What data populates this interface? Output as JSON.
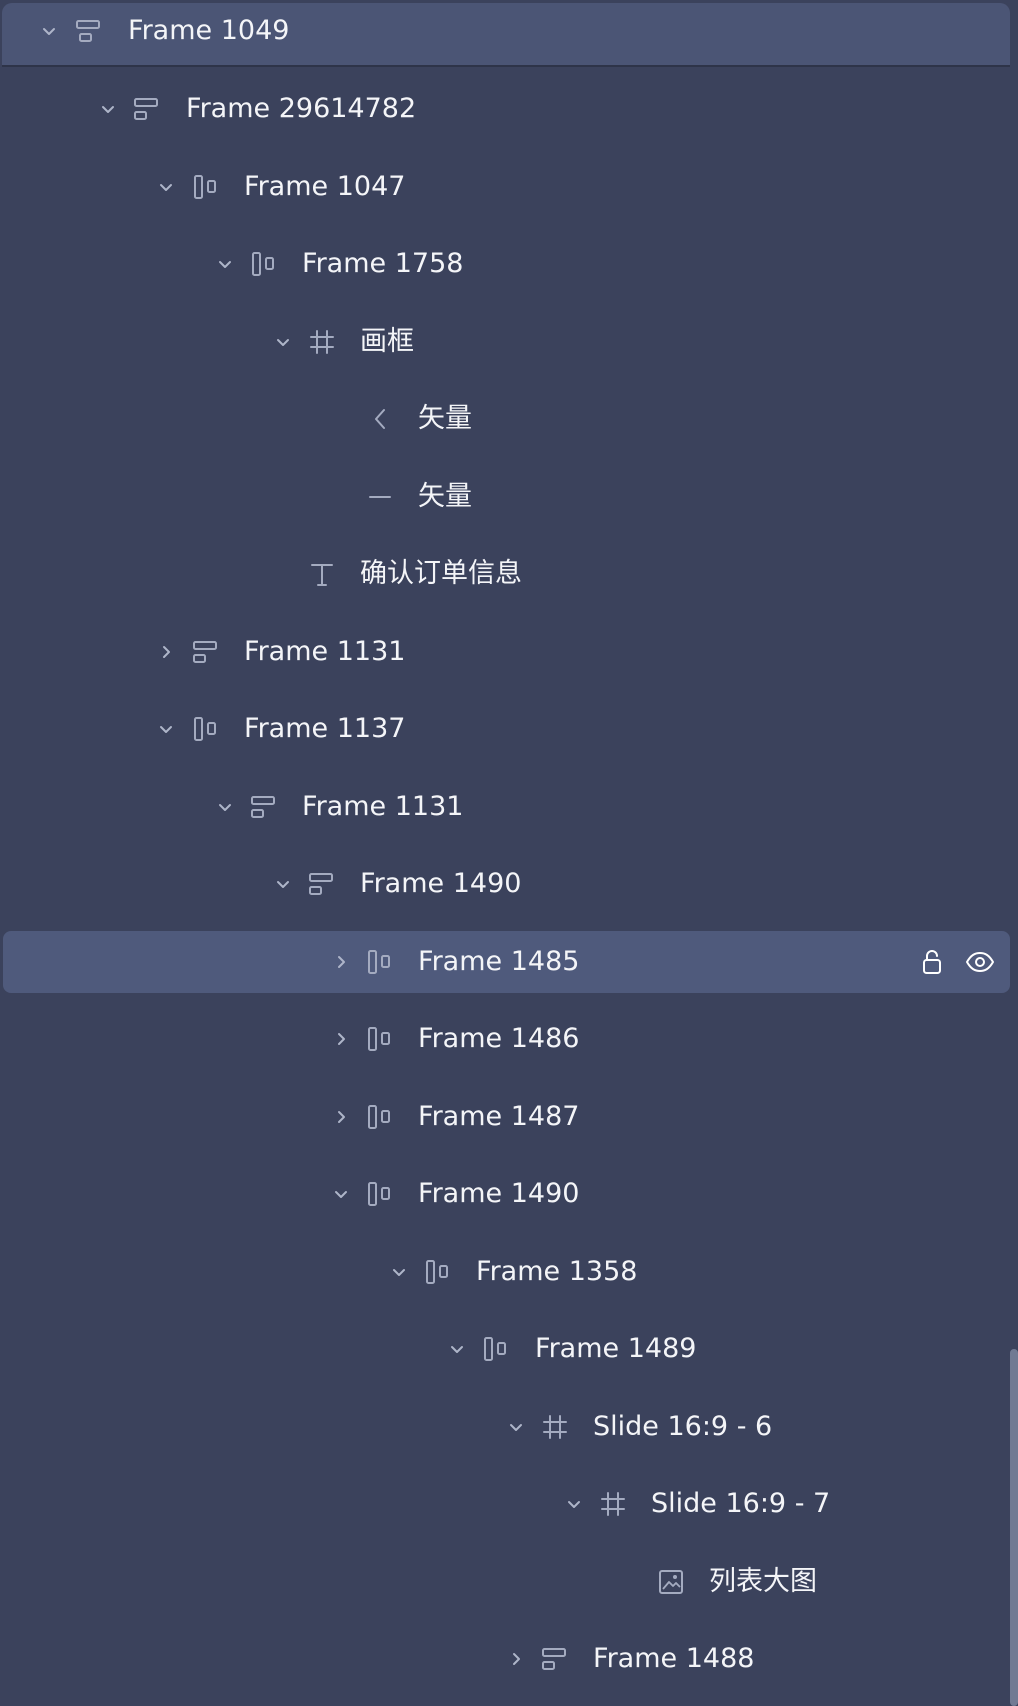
{
  "layers": {
    "header_label": "Frame 1049",
    "items": [
      {
        "label": "Frame 29614782"
      },
      {
        "label": "Frame 1047"
      },
      {
        "label": "Frame 1758"
      },
      {
        "label": "画框"
      },
      {
        "label": "矢量"
      },
      {
        "label": "矢量"
      },
      {
        "label": "确认订单信息"
      },
      {
        "label": "Frame 1131"
      },
      {
        "label": "Frame 1137"
      },
      {
        "label": "Frame 1131"
      },
      {
        "label": "Frame 1490"
      },
      {
        "label": "Frame 1485"
      },
      {
        "label": "Frame 1486"
      },
      {
        "label": "Frame 1487"
      },
      {
        "label": "Frame 1490"
      },
      {
        "label": "Frame 1358"
      },
      {
        "label": "Frame 1489"
      },
      {
        "label": "Slide 16:9 - 6"
      },
      {
        "label": "Slide 16:9 - 7"
      },
      {
        "label": "列表大图"
      },
      {
        "label": "Frame 1488"
      }
    ]
  },
  "colors": {
    "panel_background": "#3b425c",
    "header_background": "#4b5575",
    "selected_row_background": "#4f5a7c",
    "label_text": "#f4f5f8",
    "icon": "#a4abc0"
  },
  "icons": {
    "vertical_auto_layout": "auto-layout-vertical-icon",
    "horizontal_auto_layout": "auto-layout-horizontal-icon",
    "frame": "frame-hash-icon",
    "vector_chevron": "vector-chevron-icon",
    "vector_line": "vector-line-icon",
    "text": "text-icon",
    "image": "image-icon",
    "lock": "lock-icon",
    "visibility": "eye-icon"
  }
}
